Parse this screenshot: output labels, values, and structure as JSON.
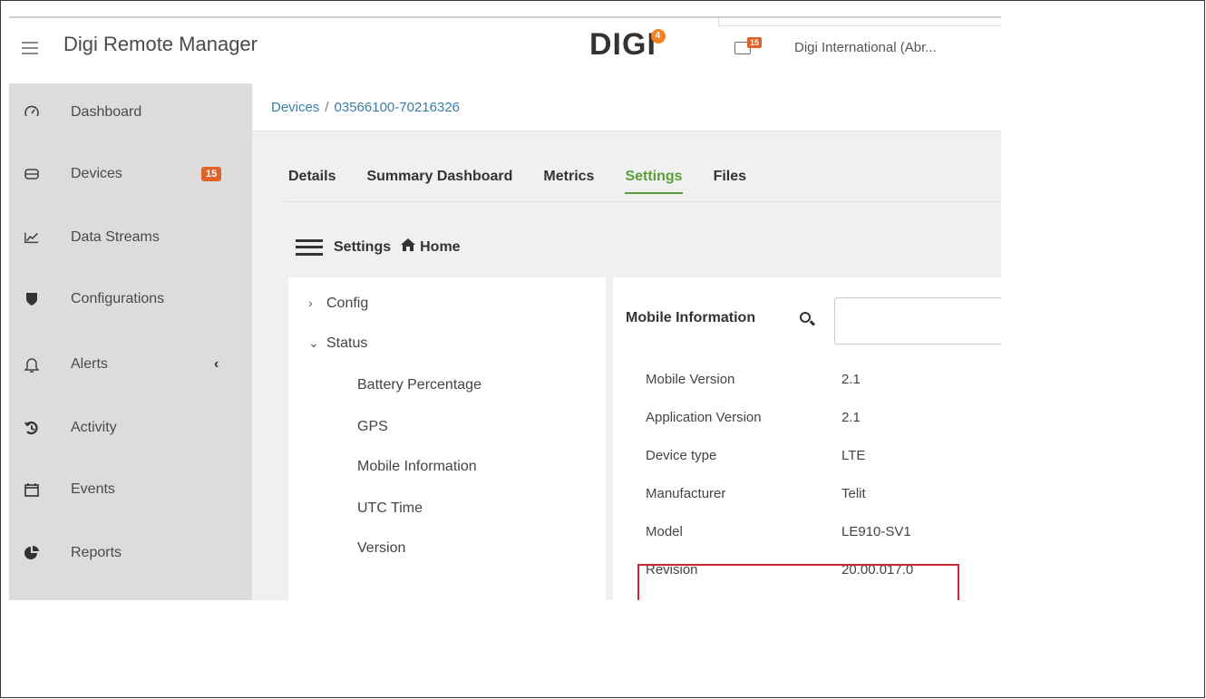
{
  "app": {
    "title": "Digi Remote Manager",
    "logo_text": "DIGI",
    "logo_badge": "4",
    "mail_count": "15",
    "org_name": "Digi International (Abr..."
  },
  "sidebar": {
    "items": [
      {
        "label": "Dashboard",
        "icon": "gauge-icon"
      },
      {
        "label": "Devices",
        "icon": "device-icon",
        "badge": "15"
      },
      {
        "label": "Data Streams",
        "icon": "chart-line-icon"
      },
      {
        "label": "Configurations",
        "icon": "shield-icon"
      },
      {
        "label": "Alerts",
        "icon": "bell-icon",
        "chevron": "‹"
      },
      {
        "label": "Activity",
        "icon": "history-icon"
      },
      {
        "label": "Events",
        "icon": "calendar-icon"
      },
      {
        "label": "Reports",
        "icon": "pie-chart-icon"
      }
    ]
  },
  "breadcrumb": {
    "root": "Devices",
    "separator": "/",
    "current": "03566100-70216326"
  },
  "tabs": [
    {
      "label": "Details"
    },
    {
      "label": "Summary Dashboard"
    },
    {
      "label": "Metrics"
    },
    {
      "label": "Settings",
      "active": true
    },
    {
      "label": "Files"
    }
  ],
  "settings_header": {
    "label": "Settings",
    "home": "Home"
  },
  "tree": {
    "config": "Config",
    "status": "Status",
    "children": [
      "Battery Percentage",
      "GPS",
      "Mobile Information",
      "UTC Time",
      "Version"
    ]
  },
  "detail": {
    "title": "Mobile Information",
    "rows": [
      {
        "label": "Mobile Version",
        "value": "2.1"
      },
      {
        "label": "Application Version",
        "value": "2.1"
      },
      {
        "label": "Device type",
        "value": "LTE"
      },
      {
        "label": "Manufacturer",
        "value": "Telit"
      },
      {
        "label": "Model",
        "value": "LE910-SV1"
      },
      {
        "label": "Revision",
        "value": "20.00.017.0"
      }
    ]
  },
  "colors": {
    "accent_green": "#5a9e3a",
    "badge_orange": "#e0622a",
    "highlight_red": "#c8282f",
    "link_blue": "#3a7fa6"
  }
}
